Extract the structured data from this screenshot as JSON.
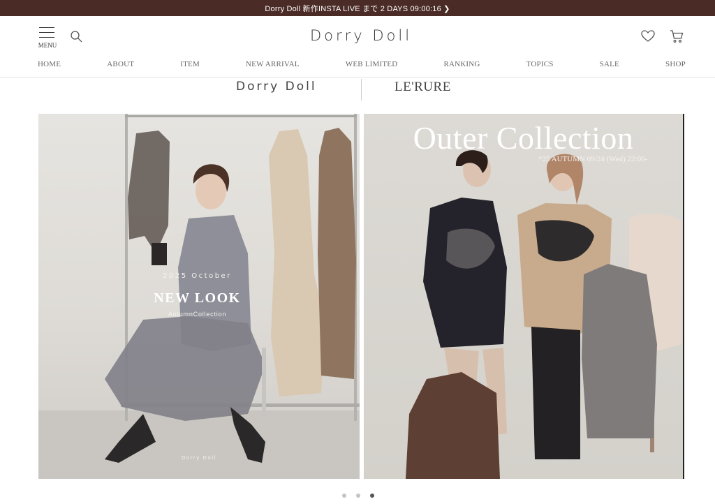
{
  "announcement": {
    "text": "Dorry Doll 新作INSTA LIVE  まで 2 DAYS 09:00:16 ❯"
  },
  "header": {
    "menu_label": "MENU",
    "logo": "Dorry Doll",
    "icons": {
      "menu": "hamburger-menu-icon",
      "search": "search-icon",
      "favorite": "heart-icon",
      "cart": "cart-icon"
    }
  },
  "nav": {
    "items": [
      "HOME",
      "ABOUT",
      "ITEM",
      "NEW ARRIVAL",
      "WEB LIMITED",
      "RANKING",
      "TOPICS",
      "SALE",
      "SHOP"
    ]
  },
  "brands": {
    "dorry_doll": "Dorry Doll",
    "lerure": "LE'RURE"
  },
  "slides": {
    "left": {
      "date": "2025 October",
      "title": "NEW LOOK",
      "subtitle": "AutumnCollection",
      "brand": "Dorry Doll"
    },
    "right": {
      "title": "Outer Collection",
      "subtitle": "*25 AUTUMN  09/24 (Wed) 22:00-"
    }
  },
  "carousel": {
    "dot_count": 3,
    "active_index": 2
  },
  "colors": {
    "announcement_bg": "#4a2b26",
    "text": "#333333",
    "nav_text": "#666666"
  }
}
